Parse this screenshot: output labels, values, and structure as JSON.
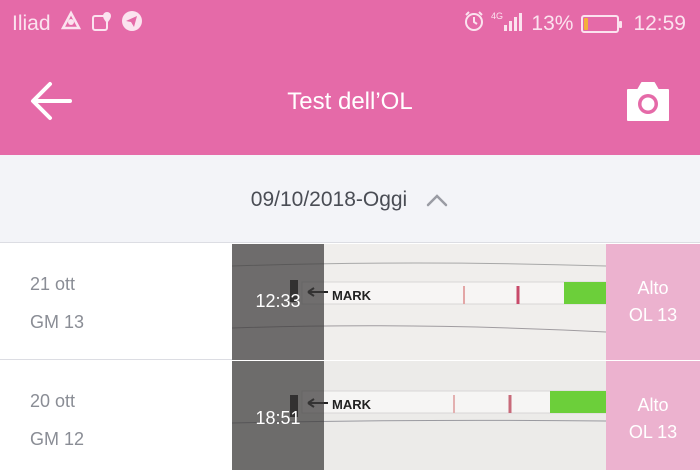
{
  "status_bar": {
    "carrier": "Iliad",
    "network": "4G",
    "battery_percent": "13%",
    "battery_level": 0.13,
    "time": "12:59",
    "icons": [
      "avast-icon",
      "location-icon",
      "telegram-icon",
      "alarm-icon",
      "signal-icon",
      "battery-icon"
    ]
  },
  "app_bar": {
    "title": "Test dell’OL",
    "back_icon": "arrow-left-icon",
    "camera_icon": "camera-icon"
  },
  "filter": {
    "date_range": "09/10/2018-Oggi",
    "toggle_icon": "chevron-up-icon"
  },
  "tests": [
    {
      "date": "21 ott",
      "cycle_day": "GM 13",
      "time": "12:33",
      "result_level": "Alto",
      "result_value": "OL 13",
      "strip_mark": "MARK"
    },
    {
      "date": "20 ott",
      "cycle_day": "GM 12",
      "time": "18:51",
      "result_level": "Alto",
      "result_value": "OL 13",
      "strip_mark": "MARK"
    }
  ],
  "colors": {
    "brand_pink": "#e56aa8",
    "result_pink": "#ecb2cf",
    "filter_bg": "#f3f4f8",
    "strip_green": "#6ccf3a"
  }
}
